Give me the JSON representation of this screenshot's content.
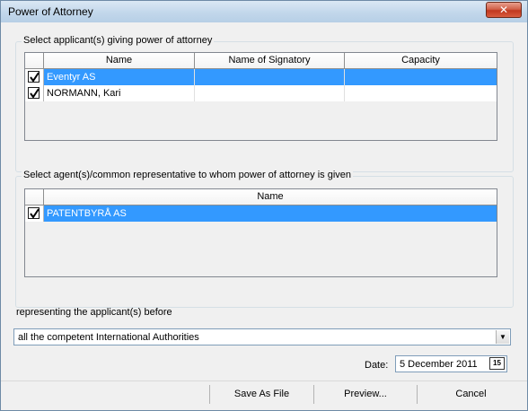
{
  "window": {
    "title": "Power of Attorney",
    "close_glyph": "✕"
  },
  "applicants": {
    "legend": "Select applicant(s) giving power of attorney",
    "columns": [
      "Name",
      "Name of Signatory",
      "Capacity"
    ],
    "rows": [
      {
        "checked": true,
        "name": "Eventyr AS",
        "signatory": "",
        "capacity": "",
        "selected": true
      },
      {
        "checked": true,
        "name": "NORMANN, Kari",
        "signatory": "",
        "capacity": "",
        "selected": false
      }
    ]
  },
  "agents": {
    "legend": "Select agent(s)/common representative to whom power of attorney is given",
    "columns": [
      "Name"
    ],
    "rows": [
      {
        "checked": true,
        "name": "PATENTBYRÅ AS",
        "selected": true
      }
    ]
  },
  "representing": {
    "label": "representing the applicant(s) before",
    "selected": "all the competent International Authorities"
  },
  "date": {
    "label": "Date:",
    "value": "5 December 2011",
    "calendar_icon_text": "15"
  },
  "buttons": {
    "save": "Save As File",
    "preview": "Preview...",
    "cancel": "Cancel"
  },
  "colors": {
    "selection": "#3399ff",
    "close_button": "#c1381f"
  }
}
